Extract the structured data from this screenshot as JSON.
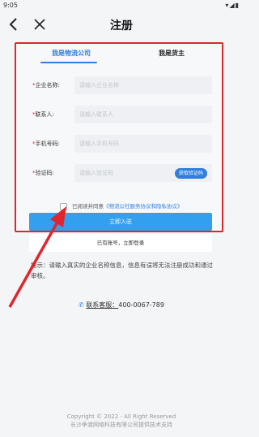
{
  "status_bar": {
    "time": "9:05",
    "icons": "▾◢▮"
  },
  "header": {
    "title": "注册"
  },
  "tabs": [
    {
      "label": "我是物流公司",
      "active": true
    },
    {
      "label": "我是货主",
      "active": false
    }
  ],
  "form": {
    "company": {
      "label": "企业名称:",
      "placeholder": "请输入企业名称"
    },
    "contact": {
      "label": "联系人:",
      "placeholder": "请输入联系人"
    },
    "phone": {
      "label": "手机号码:",
      "placeholder": "请输入手机号码"
    },
    "captcha": {
      "label": "验证码:",
      "placeholder": "请输入验证码",
      "button": "获取验证码"
    },
    "required_mark": "*"
  },
  "agreement": {
    "prefix": "已阅读并同意",
    "link": "《物流公社服务协议和隐私协议》"
  },
  "buttons": {
    "register": "立即入驻",
    "login": "已有账号，立即登录"
  },
  "notice": "提示：请输入真实的企业名称信息，信息有误将无法注册成功和通过审核。",
  "hotline": {
    "label": "联系客服：",
    "number": "400-0067-789"
  },
  "footer": {
    "copyright": "Copyright © 2022 - All Right Reserved",
    "support": "长沙争渡网络科技有限公司提供技术支持"
  },
  "colors": {
    "accent": "#2f7fe0",
    "highlight": "#e0262d",
    "button": "#33a0ef"
  }
}
